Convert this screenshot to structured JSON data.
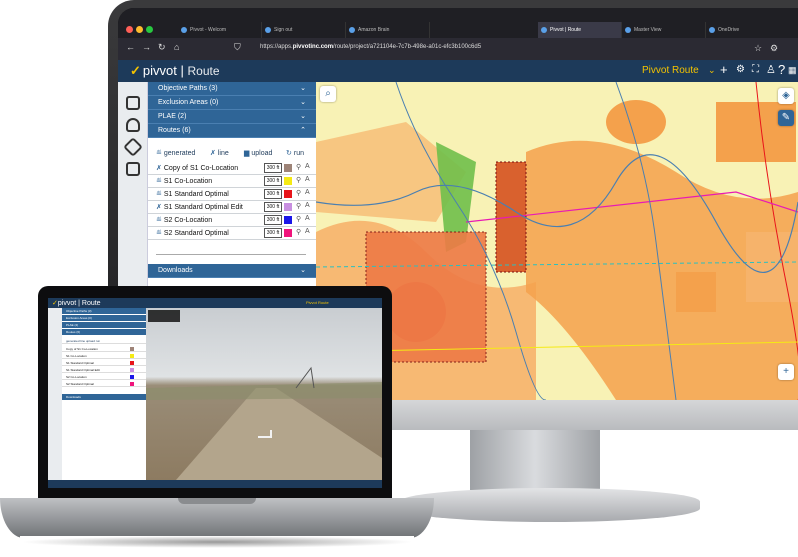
{
  "browser": {
    "tabs": [
      "Pivvot - Welcom",
      "Sign out",
      "Amazon Brain",
      "Pivvot | Route",
      "Master View",
      "OneDrive"
    ],
    "active_tab": "Pivvot | Route",
    "url_prefix": "https://apps.",
    "url_domain": "pivvotinc.com",
    "url_path": "/route/project/a721104e-7c7b-498e-a01c-efc3b100c6d5"
  },
  "app": {
    "logo_text": "pivvot",
    "logo_sub": "Route",
    "header_title": "Pivvot Route",
    "brand_color": "#1d3a5a",
    "accent_color": "#f4c300",
    "panel_color": "#2f6597"
  },
  "sidebar": {
    "sections": [
      {
        "label": "Objective Paths (3)",
        "expanded": false
      },
      {
        "label": "Exclusion Areas (0)",
        "expanded": false
      },
      {
        "label": "PLAE (2)",
        "expanded": false
      },
      {
        "label": "Routes (6)",
        "expanded": true
      }
    ],
    "route_tools": {
      "generated": "generated",
      "line": "line",
      "upload": "upload",
      "run": "run"
    },
    "routes": [
      {
        "name": "Copy of S1 Co-Location",
        "distance": "300 ft",
        "color": "#9e8478",
        "icon": "line-icon"
      },
      {
        "name": "S1 Co-Location",
        "distance": "300 ft",
        "color": "#f5ea14",
        "icon": "generated-icon"
      },
      {
        "name": "S1 Standard Optimal",
        "distance": "300 ft",
        "color": "#e8141a",
        "icon": "generated-icon"
      },
      {
        "name": "S1 Standard Optimal Edit",
        "distance": "300 ft",
        "color": "#c88fe0",
        "icon": "line-icon"
      },
      {
        "name": "S2 Co-Location",
        "distance": "300 ft",
        "color": "#1a16e8",
        "icon": "generated-icon"
      },
      {
        "name": "S2 Standard Optimal",
        "distance": "300 ft",
        "color": "#f0147c",
        "icon": "generated-icon"
      }
    ],
    "downloads_label": "Downloads"
  },
  "caret_down": "⌄",
  "caret_up": "⌃"
}
